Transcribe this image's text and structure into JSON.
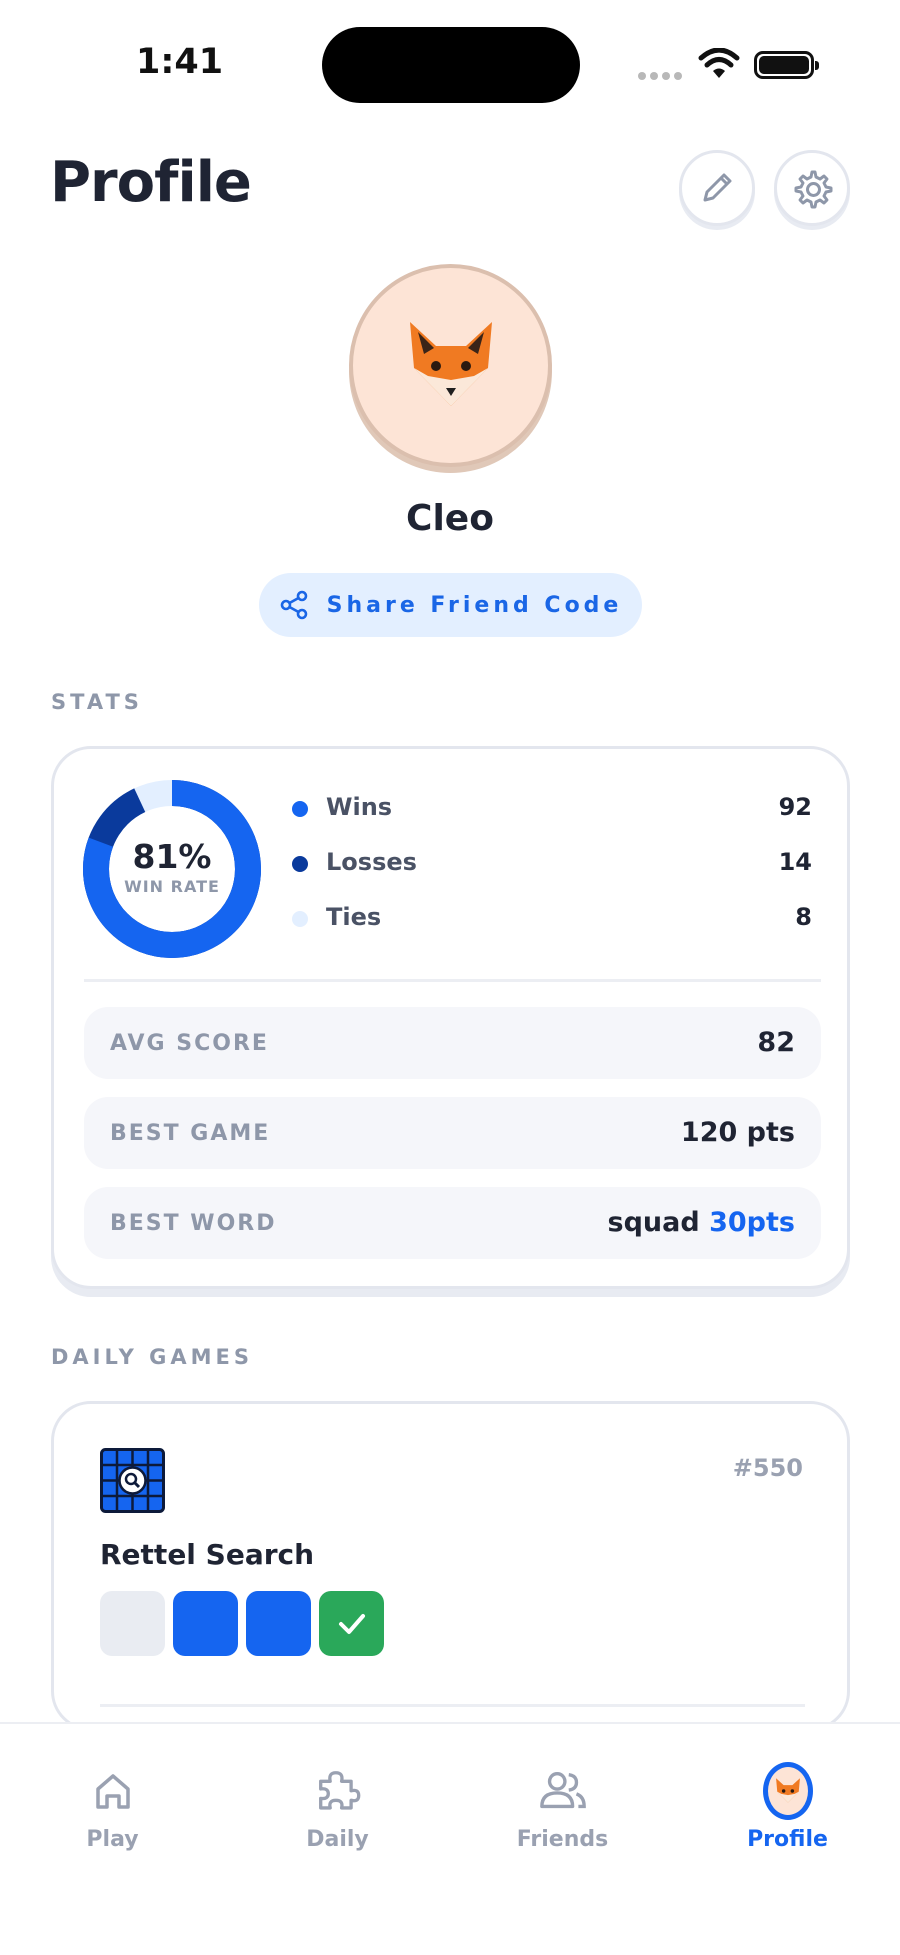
{
  "status_bar": {
    "time": "1:41"
  },
  "header": {
    "title": "Profile",
    "edit_icon": "pencil-icon",
    "settings_icon": "gear-icon"
  },
  "profile": {
    "avatar_icon": "fox-icon",
    "name": "Cleo",
    "share_label": "Share Friend Code",
    "share_icon": "share-icon"
  },
  "stats": {
    "section_label": "STATS",
    "win_rate": "81%",
    "win_rate_label": "WIN RATE",
    "win_rate_value": 0.81,
    "legend": [
      {
        "label": "Wins",
        "value": "92",
        "color": "#1565f0"
      },
      {
        "label": "Losses",
        "value": "14",
        "color": "#0a3a9c"
      },
      {
        "label": "Ties",
        "value": "8",
        "color": "#e3efff"
      }
    ],
    "rows": [
      {
        "label": "AVG SCORE",
        "value": "82"
      },
      {
        "label": "BEST GAME",
        "value": "120 pts"
      },
      {
        "label": "BEST WORD",
        "value": "squad",
        "accent": "30pts"
      }
    ]
  },
  "daily": {
    "section_label": "DAILY GAMES",
    "game": {
      "title": "Rettel Search",
      "number": "#550",
      "icon": "grid-search-icon",
      "tiles": [
        "empty",
        "blue",
        "blue",
        "check"
      ]
    }
  },
  "tab_bar": {
    "tabs": [
      {
        "label": "Play",
        "icon": "home-icon"
      },
      {
        "label": "Daily",
        "icon": "puzzle-icon"
      },
      {
        "label": "Friends",
        "icon": "people-icon"
      },
      {
        "label": "Profile",
        "icon": "fox-avatar-icon",
        "active": true
      }
    ]
  },
  "colors": {
    "accent": "#1565f0",
    "dark_accent": "#0a3a9c",
    "success": "#2aa85a",
    "muted": "#8e97a9"
  }
}
